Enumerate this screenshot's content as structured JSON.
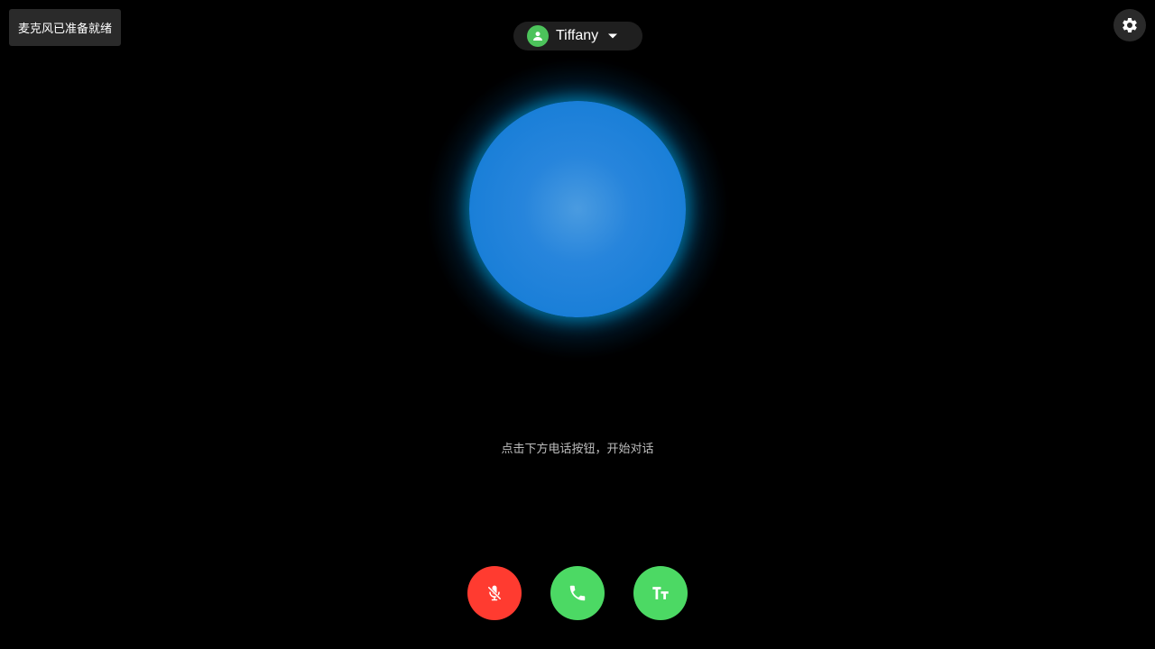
{
  "status": {
    "mic_ready": "麦克风已准备就绪"
  },
  "character": {
    "name": "Tiffany",
    "avatar_icon": "person-icon",
    "avatar_color": "#4cc35b",
    "dropdown_icon": "caret-down-icon"
  },
  "settings": {
    "icon": "gear-icon"
  },
  "orb": {
    "color": "#1e82dc",
    "glow_color": "#00b4f0"
  },
  "hint": {
    "text": "点击下方电话按钮，开始对话"
  },
  "controls": [
    {
      "id": "mute",
      "icon": "mic-off-icon",
      "color": "#ff3b30"
    },
    {
      "id": "call",
      "icon": "phone-icon",
      "color": "#4cd964"
    },
    {
      "id": "text",
      "icon": "text-size-icon",
      "color": "#4cd964"
    }
  ]
}
